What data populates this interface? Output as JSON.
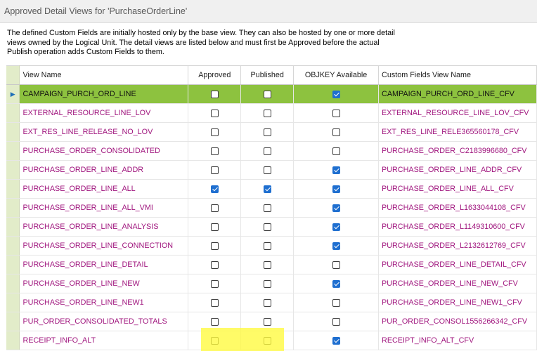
{
  "window": {
    "title": "Approved Detail Views for 'PurchaseOrderLine'"
  },
  "description": "The defined Custom Fields are initially hosted only by the base view. They can also be hosted by one or more detail views owned by the Logical Unit. The detail views are listed below and must first be Approved before the actual Publish operation adds Custom Fields to them.",
  "grid": {
    "columns": {
      "view_name": "View Name",
      "approved": "Approved",
      "published": "Published",
      "objkey": "OBJKEY Available",
      "cfv_name": "Custom Fields View Name"
    },
    "current_row_marker": "▶",
    "rows": [
      {
        "view_name": "CAMPAIGN_PURCH_ORD_LINE",
        "approved": false,
        "published": false,
        "objkey": true,
        "cfv_name": "CAMPAIGN_PURCH_ORD_LINE_CFV",
        "selected": true
      },
      {
        "view_name": "EXTERNAL_RESOURCE_LINE_LOV",
        "approved": false,
        "published": false,
        "objkey": false,
        "cfv_name": "EXTERNAL_RESOURCE_LINE_LOV_CFV"
      },
      {
        "view_name": "EXT_RES_LINE_RELEASE_NO_LOV",
        "approved": false,
        "published": false,
        "objkey": false,
        "cfv_name": "EXT_RES_LINE_RELE365560178_CFV"
      },
      {
        "view_name": "PURCHASE_ORDER_CONSOLIDATED",
        "approved": false,
        "published": false,
        "objkey": false,
        "cfv_name": "PURCHASE_ORDER_C2183996680_CFV"
      },
      {
        "view_name": "PURCHASE_ORDER_LINE_ADDR",
        "approved": false,
        "published": false,
        "objkey": true,
        "cfv_name": "PURCHASE_ORDER_LINE_ADDR_CFV"
      },
      {
        "view_name": "PURCHASE_ORDER_LINE_ALL",
        "approved": true,
        "published": true,
        "objkey": true,
        "cfv_name": "PURCHASE_ORDER_LINE_ALL_CFV"
      },
      {
        "view_name": "PURCHASE_ORDER_LINE_ALL_VMI",
        "approved": false,
        "published": false,
        "objkey": true,
        "cfv_name": "PURCHASE_ORDER_L1633044108_CFV"
      },
      {
        "view_name": "PURCHASE_ORDER_LINE_ANALYSIS",
        "approved": false,
        "published": false,
        "objkey": true,
        "cfv_name": "PURCHASE_ORDER_L1149310600_CFV"
      },
      {
        "view_name": "PURCHASE_ORDER_LINE_CONNECTION",
        "approved": false,
        "published": false,
        "objkey": true,
        "cfv_name": "PURCHASE_ORDER_L2132612769_CFV"
      },
      {
        "view_name": "PURCHASE_ORDER_LINE_DETAIL",
        "approved": false,
        "published": false,
        "objkey": false,
        "cfv_name": "PURCHASE_ORDER_LINE_DETAIL_CFV"
      },
      {
        "view_name": "PURCHASE_ORDER_LINE_NEW",
        "approved": false,
        "published": false,
        "objkey": true,
        "cfv_name": "PURCHASE_ORDER_LINE_NEW_CFV"
      },
      {
        "view_name": "PURCHASE_ORDER_LINE_NEW1",
        "approved": false,
        "published": false,
        "objkey": false,
        "cfv_name": "PURCHASE_ORDER_LINE_NEW1_CFV"
      },
      {
        "view_name": "PUR_ORDER_CONSOLIDATED_TOTALS",
        "approved": false,
        "published": false,
        "objkey": false,
        "cfv_name": "PUR_ORDER_CONSOL1556266342_CFV"
      },
      {
        "view_name": "RECEIPT_INFO_ALT",
        "approved": false,
        "published": false,
        "objkey": true,
        "cfv_name": "RECEIPT_INFO_ALT_CFV",
        "highlighted": true
      }
    ]
  },
  "colors": {
    "selected_row": "#8dc23f",
    "indicator_column": "#e2ecc9",
    "link_text": "#a0167e",
    "checkbox_checked": "#1f6fd0",
    "highlight": "#fffa3c"
  }
}
